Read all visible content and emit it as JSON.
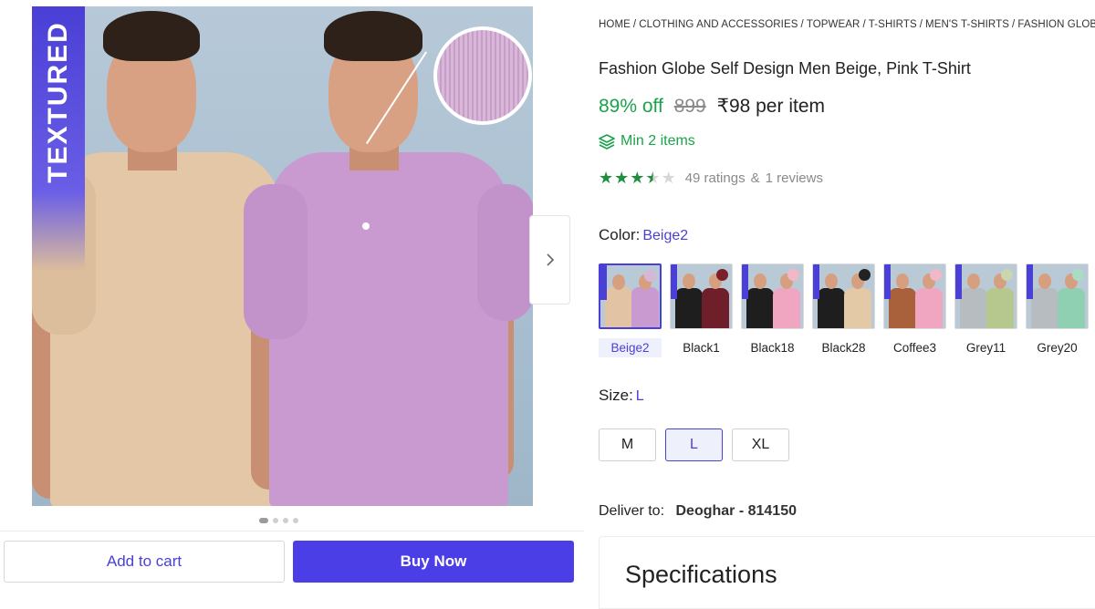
{
  "gallery": {
    "badge_text": "TEXTURED",
    "next_icon": "chevron-right-icon",
    "dots": {
      "count": 4,
      "active_index": 0
    }
  },
  "actions": {
    "add_to_cart_label": "Add to cart",
    "buy_now_label": "Buy Now"
  },
  "breadcrumb": [
    "HOME",
    "CLOTHING AND ACCESSORIES",
    "TOPWEAR",
    "T-SHIRTS",
    "MEN'S T-SHIRTS",
    "FASHION GLOBE"
  ],
  "product": {
    "title": "Fashion Globe Self Design Men Beige, Pink T-Shirt",
    "discount": "89% off",
    "mrp": "899",
    "price": "₹98 per item",
    "min_items": "Min 2 items",
    "rating_value": 3.5,
    "ratings_text": "49 ratings",
    "amp": "&",
    "reviews_text": "1 reviews"
  },
  "color": {
    "label": "Color:",
    "selected": "Beige2",
    "options": [
      {
        "name": "Beige2",
        "shirt1": "#e2c4a5",
        "shirt2": "#c99ad0",
        "circle": "#d7b7d7",
        "selected": true
      },
      {
        "name": "Black1",
        "shirt1": "#1e1e1e",
        "shirt2": "#6e1f2a",
        "circle": "#7a1f2b",
        "selected": false
      },
      {
        "name": "Black18",
        "shirt1": "#1e1e1e",
        "shirt2": "#f0a6c0",
        "circle": "#f2b7c8",
        "selected": false
      },
      {
        "name": "Black28",
        "shirt1": "#1e1e1e",
        "shirt2": "#e4c9a7",
        "circle": "#222222",
        "selected": false
      },
      {
        "name": "Coffee3",
        "shirt1": "#a8613a",
        "shirt2": "#f0a6c0",
        "circle": "#f2b7c8",
        "selected": false
      },
      {
        "name": "Grey11",
        "shirt1": "#b7bcc1",
        "shirt2": "#b7c88f",
        "circle": "#cbd5b0",
        "selected": false
      },
      {
        "name": "Grey20",
        "shirt1": "#b7bcc1",
        "shirt2": "#8fcfb2",
        "circle": "#a8dcc3",
        "selected": false
      }
    ]
  },
  "size": {
    "label": "Size:",
    "selected": "L",
    "options": [
      "M",
      "L",
      "XL"
    ]
  },
  "delivery": {
    "label": "Deliver to:",
    "location": "Deoghar - 814150"
  },
  "specifications": {
    "title": "Specifications"
  },
  "icons": {
    "min_items": "layers-icon",
    "star": "star-icon"
  },
  "colors": {
    "accent": "#4a3fd6",
    "buy_button": "#4c3ee6",
    "discount_green": "#1aa34a",
    "star_green": "#1e8f3d"
  }
}
